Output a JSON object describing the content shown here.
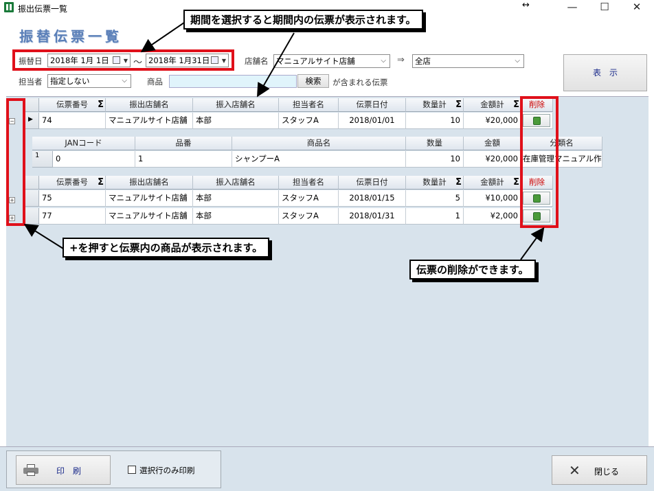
{
  "window": {
    "title": "振出伝票一覧"
  },
  "page": {
    "title": "振替伝票一覧"
  },
  "filters": {
    "date_label": "振替日",
    "date_from": "2018年  1月  1日",
    "tilde": "～",
    "date_to": "2018年  1月31日",
    "store_label": "店舗名",
    "store_from": "マニュアルサイト店舗",
    "arrow": "⇒",
    "store_to": "全店",
    "staff_label": "担当者",
    "staff_value": "指定しない",
    "product_label": "商品",
    "product_value": "",
    "search_button": "検索",
    "contains_text": "が含まれる伝票",
    "show_button": "表　示"
  },
  "grid": {
    "headers": [
      "伝票番号",
      "振出店舗名",
      "振入店舗名",
      "担当者名",
      "伝票日付",
      "数量計",
      "金額計",
      "削除"
    ],
    "detail_headers": [
      "JANコード",
      "品番",
      "商品名",
      "数量",
      "金額",
      "分類名"
    ],
    "rows": [
      {
        "no": "74",
        "from": "マニュアルサイト店舗",
        "to": "本部",
        "staff": "スタッフA",
        "date": "2018/01/01",
        "qty": "10",
        "amount": "¥20,000"
      },
      {
        "no": "75",
        "from": "マニュアルサイト店舗",
        "to": "本部",
        "staff": "スタッフA",
        "date": "2018/01/15",
        "qty": "5",
        "amount": "¥10,000"
      },
      {
        "no": "77",
        "from": "マニュアルサイト店舗",
        "to": "本部",
        "staff": "スタッフA",
        "date": "2018/01/31",
        "qty": "1",
        "amount": "¥2,000"
      }
    ],
    "detail_row": {
      "index": "1",
      "jan": "0",
      "part": "1",
      "name": "シャンプーA",
      "qty": "10",
      "amount": "¥20,000",
      "category": "在庫管理マニュアル作"
    }
  },
  "annotations": {
    "period": "期間を選択すると期間内の伝票が表示されます。",
    "expand": "+を押すと伝票内の商品が表示されます。",
    "delete": "伝票の削除ができます。"
  },
  "footer": {
    "print_button": "印　刷",
    "print_selected": "選択行のみ印刷",
    "close_button": "閉じる"
  },
  "colors": {
    "accent_red": "#e0101a",
    "title_blue": "#5a7fb8",
    "grid_bg": "#d8e3ec"
  }
}
